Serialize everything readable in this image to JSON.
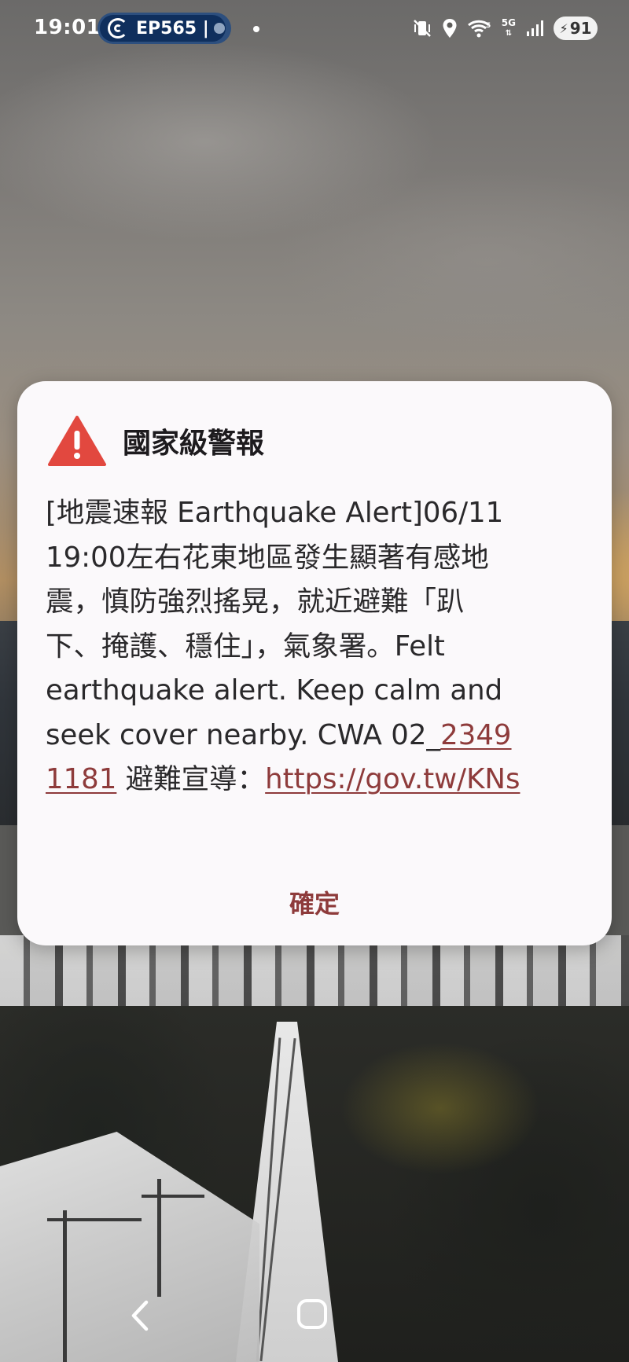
{
  "status_bar": {
    "time": "19:01",
    "live_activity": "EP565 |",
    "battery": "91",
    "network": "5G"
  },
  "alert": {
    "title": "國家級警報",
    "body_lines": [
      "[地震速報 Earthquake Alert]06/11",
      "19:00左右花東地區發生顯著有感地",
      "震，慎防強烈搖晃，就近避難「趴",
      "下、掩護、穩住」，氣象署。Felt",
      "earthquake alert. Keep calm and"
    ],
    "line6_text": "seek cover nearby. CWA 02_",
    "phone_part1": "2349",
    "phone_part2": "1181",
    "evac_label": " 避難宣導：",
    "url": "https://gov.tw/KNs",
    "confirm_button": "確定",
    "accent_color": "#8e3b3b",
    "warning_color": "#e2483f"
  },
  "icons": {
    "warning": "warning-triangle-icon",
    "mute": "vibrate-icon",
    "location": "location-pin-icon",
    "wifi": "wifi-icon",
    "signal": "cell-signal-icon",
    "back": "back-icon",
    "home": "home-icon"
  }
}
